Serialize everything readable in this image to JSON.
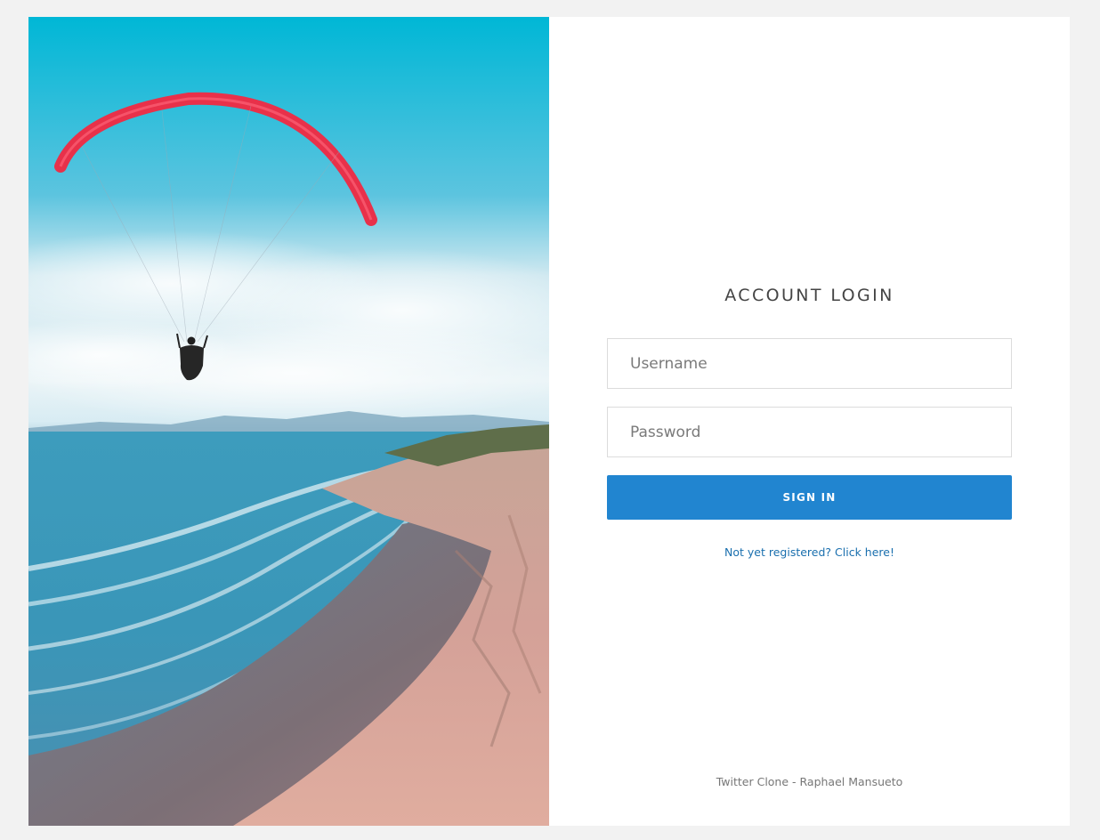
{
  "login": {
    "title": "ACCOUNT LOGIN",
    "username_placeholder": "Username",
    "password_placeholder": "Password",
    "signin_label": "SIGN IN",
    "register_link": "Not yet registered? Click here!",
    "footer": "Twitter Clone - Raphael Mansueto"
  },
  "colors": {
    "primary": "#2185d0",
    "link": "#1a6fae",
    "background": "#f2f2f2",
    "card": "#ffffff"
  },
  "hero": {
    "icons": [
      "paraglider-wing-icon",
      "paraglider-pilot-icon"
    ]
  }
}
